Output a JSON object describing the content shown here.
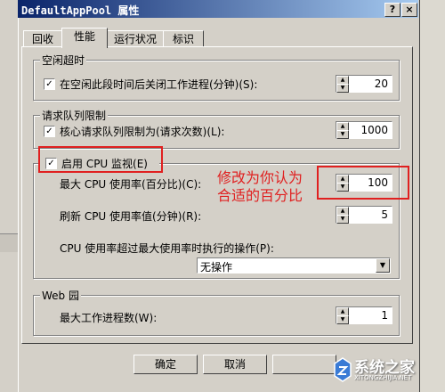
{
  "window": {
    "title": "DefaultAppPool 属性",
    "help_button": "?",
    "close_button": "×"
  },
  "tabs": [
    {
      "label": "回收",
      "active": false
    },
    {
      "label": "性能",
      "active": true
    },
    {
      "label": "运行状况",
      "active": false
    },
    {
      "label": "标识",
      "active": false
    }
  ],
  "idle_timeout": {
    "group_label": "空闲超时",
    "checkbox_label": "在空闲此段时间后关闭工作进程(分钟)(S):",
    "checked": true,
    "value": "20"
  },
  "request_queue": {
    "group_label": "请求队列限制",
    "checkbox_label": "核心请求队列限制为(请求次数)(L):",
    "checked": true,
    "value": "1000"
  },
  "cpu": {
    "checkbox_label": "启用 CPU 监视(E)",
    "checked": true,
    "max_usage_label": "最大 CPU 使用率(百分比)(C):",
    "max_usage_value": "100",
    "refresh_label": "刷新 CPU 使用率值(分钟)(R):",
    "refresh_value": "5",
    "action_label": "CPU 使用率超过最大使用率时执行的操作(P):",
    "action_value": "无操作"
  },
  "annotation": {
    "line1": "修改为你认为",
    "line2": "合适的百分比",
    "color": "#e02020"
  },
  "web_garden": {
    "group_label": "Web 园",
    "max_processes_label": "最大工作进程数(W):",
    "max_processes_value": "1"
  },
  "buttons": {
    "ok": "确定",
    "cancel": "取消"
  },
  "watermark": {
    "text": "系统之家",
    "sub": "XITONGZHIJIA.NET"
  },
  "colors": {
    "titlebar_start": "#0a246a",
    "titlebar_end": "#a6caf0",
    "highlight": "#e02020",
    "dialog_bg": "#d4d0c8"
  }
}
